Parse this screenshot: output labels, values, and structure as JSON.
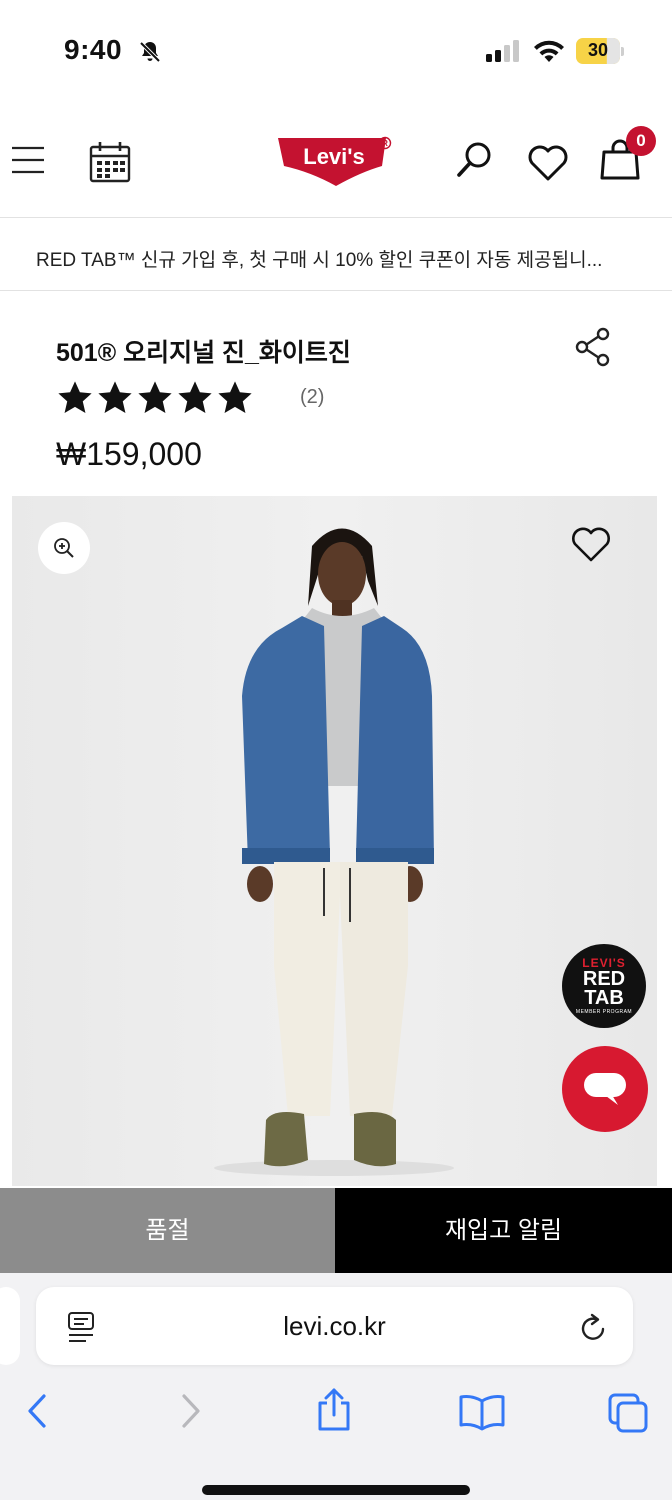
{
  "status_bar": {
    "time": "9:40",
    "battery": "30",
    "icons": [
      "bell-slash-icon",
      "signal-icon",
      "wifi-icon",
      "battery-icon"
    ]
  },
  "header": {
    "logo_text": "Levi's",
    "cart_count": "0",
    "icons": [
      "hamburger-menu-icon",
      "calendar-icon",
      "search-icon",
      "heart-icon",
      "shopping-bag-icon"
    ]
  },
  "promo": {
    "text": "RED TAB™ 신규 가입 후, 첫 구매 시 10% 할인 쿠폰이 자동 제공됩니..."
  },
  "product": {
    "name": "501® 오리지널 진_화이트진",
    "rating_stars": 5,
    "review_count": "(2)",
    "price": "₩159,000"
  },
  "gallery": {
    "icons": [
      "zoom-in-icon",
      "wishlist-heart-icon"
    ],
    "redtab_badge": {
      "line1": "LEVI'S",
      "line2": "RED",
      "line3": "TAB",
      "line4": "MEMBER PROGRAM"
    }
  },
  "actions": {
    "soldout_label": "품절",
    "restock_label": "재입고 알림"
  },
  "browser": {
    "url": "levi.co.kr",
    "icons": [
      "reader-mode-icon",
      "reload-icon",
      "back-icon",
      "forward-icon",
      "share-icon",
      "bookmarks-icon",
      "tabs-icon"
    ]
  },
  "colors": {
    "brand_red": "#c41230",
    "soldout_gray": "#8c8c8c",
    "restock_black": "#000000",
    "safari_blue": "#3478f6"
  }
}
